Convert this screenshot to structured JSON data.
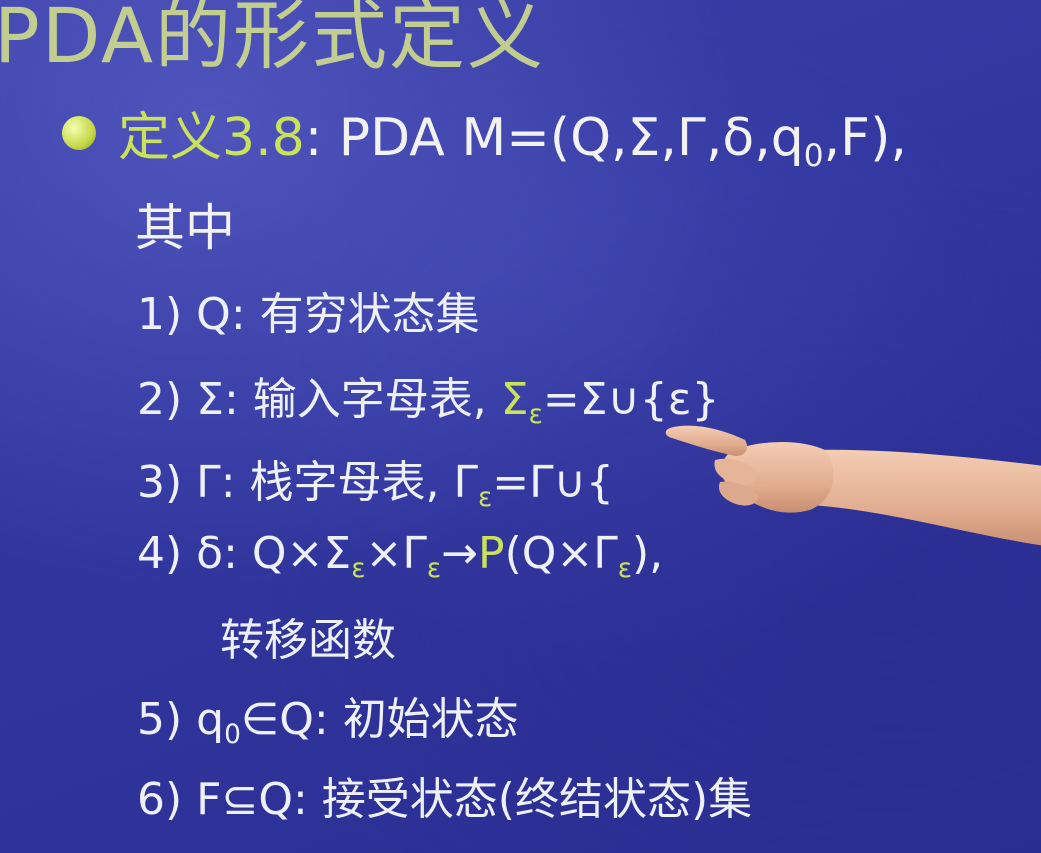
{
  "title": "PDA的形式定义",
  "definition": {
    "label": "定义3.8",
    "colon": ":",
    "prefix": " PDA M=(Q,Σ,Γ,δ,q",
    "q0_sub": "0",
    "suffix": ",F),"
  },
  "intro": "其中",
  "items": [
    {
      "num": "1)",
      "symbol": "Q",
      "desc": "有穷状态集"
    },
    {
      "num": "2)",
      "symbol": "Σ",
      "desc": "输入字母表,",
      "extra_main": "Σ",
      "extra_sub": "ε",
      "extra_rest": "=Σ∪{ε}"
    },
    {
      "num": "3)",
      "symbol": "Γ",
      "desc": "栈字母表,",
      "extra_main": "Γ",
      "extra_sub": "ε",
      "extra_rest": "=Γ∪{"
    },
    {
      "num": "4)",
      "symbol": "δ",
      "expr_a": "Q×Σ",
      "sub1": "ε",
      "expr_b": "×Γ",
      "sub2": "ε",
      "arrow": "→",
      "power": "P",
      "expr_c": "(Q×Γ",
      "sub3": "ε",
      "expr_d": "),",
      "cont": "转移函数"
    },
    {
      "num": "5)",
      "symbol": "q",
      "sub": "0",
      "rel": "∈Q",
      "desc": "初始状态"
    },
    {
      "num": "6)",
      "symbol": "F",
      "rel": "⊆Q",
      "desc": "接受状态(终结状态)集"
    }
  ],
  "colors": {
    "accent_green": "#c9e25a",
    "text": "#f2f2f2",
    "background": "#3237a0"
  }
}
